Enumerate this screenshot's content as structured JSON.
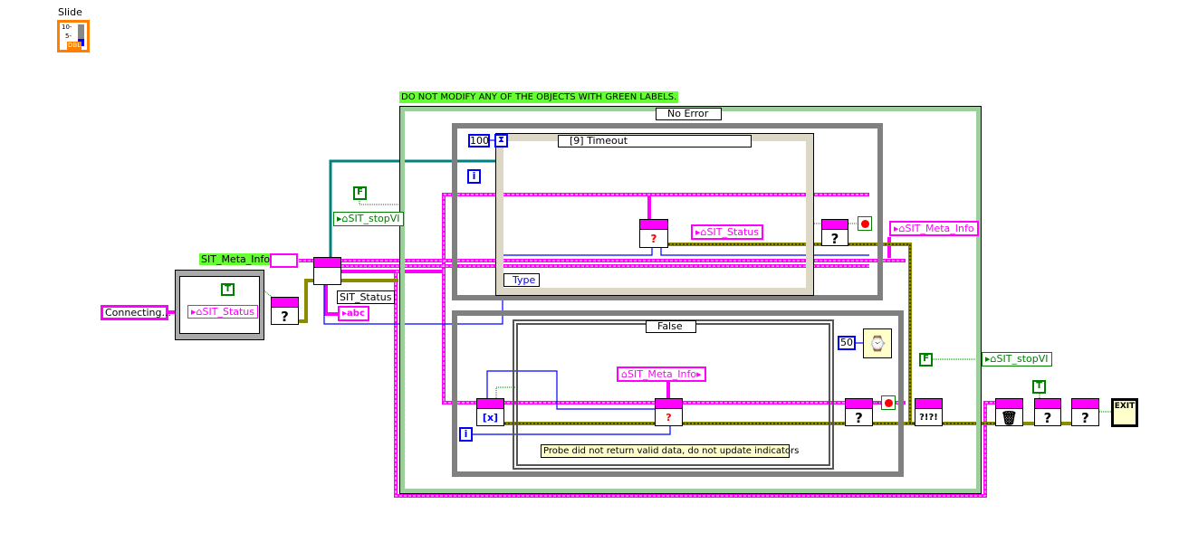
{
  "slide": {
    "label": "Slide",
    "ticks": [
      "10-",
      "5-"
    ],
    "type": "DBL"
  },
  "warning_label": "DO NOT MODIFY ANY OF THE OBJECTS WITH GREEN LABELS.",
  "case_outer": {
    "selector": "No Error"
  },
  "event_structure": {
    "timeout_const": "100",
    "selector": "[9] Timeout",
    "type_label": "Type",
    "iteration": "i",
    "status_ref": "SIT_Status"
  },
  "right_meta_ref": "SIT_Meta_Info",
  "lower_loop": {
    "case_selector": "False",
    "meta_ref": "SIT_Meta_Info",
    "wait_const": "50",
    "iteration": "i",
    "comment": "Probe did not return valid data, do not update indicators"
  },
  "left": {
    "meta_label": "SIT_Meta_Info",
    "status_string": "Connecting...",
    "status_ref": "SIT_Status",
    "stop_ref": "SIT_stopVI",
    "false_const": "F",
    "true_const": "T",
    "status_label": "SIT_Status",
    "abc": "abc"
  },
  "right": {
    "false_const": "F",
    "stop_ref": "SIT_stopVI",
    "true_const": "T",
    "exit": "EXIT"
  },
  "colors": {
    "refnum": "#ff00ff",
    "boolean": "#007f00",
    "numeric": "#0000ff",
    "error": "#8b8b00",
    "green_label": "#66ff33"
  }
}
